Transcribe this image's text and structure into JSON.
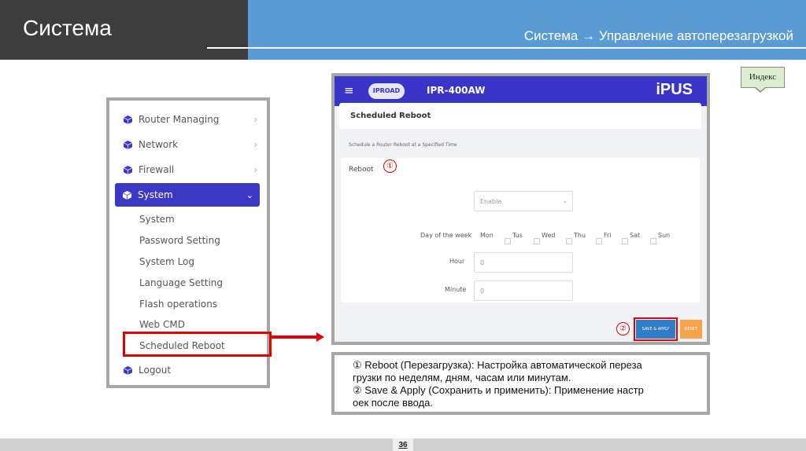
{
  "header": {
    "title": "Система",
    "subtitle": "Система → Управление автоперезагрузкой"
  },
  "index_button": "Индекс",
  "sidebar": {
    "items": [
      {
        "label": "Router Managing",
        "icon": "cube-icon"
      },
      {
        "label": "Network",
        "icon": "cube-icon"
      },
      {
        "label": "Firewall",
        "icon": "cube-icon"
      }
    ],
    "active": {
      "label": "System",
      "icon": "cube-icon"
    },
    "sub_items": [
      "System",
      "Password Setting",
      "System Log",
      "Language Setting",
      "Flash operations",
      "Web CMD",
      "Scheduled Reboot"
    ],
    "logout": "Logout"
  },
  "router": {
    "logo": "IPROAD",
    "model": "IPR-400AW",
    "brand": "iPUS",
    "page_title": "Scheduled Reboot",
    "description": "Schedule a Router Reboot at a Specified Time",
    "section_label": "Reboot",
    "marker1": "①",
    "marker2": "②",
    "enable_value": "Enable",
    "day_label": "Day of the week",
    "days": [
      "Mon",
      "Tus",
      "Wed",
      "Thu",
      "Fri",
      "Sat",
      "Sun"
    ],
    "hour_label": "Hour",
    "hour_value": "0",
    "minute_label": "Minute",
    "minute_value": "0",
    "save_label": "SAVE & APPLY",
    "reset_label": "RESET"
  },
  "notes": {
    "line1": "① Reboot (Перезагрузка): Настройка автоматической переза",
    "line2": "грузки по неделям, дням, часам или минутам.",
    "line3": "② Save & Apply (Сохранить и применить): Применение настр",
    "line4": "оек после ввода."
  },
  "page_number": "36",
  "colors": {
    "header_dark": "#3d3d3d",
    "header_blue": "#5b9bd5",
    "router_bar": "#3a35c9",
    "highlight": "#e00000"
  }
}
